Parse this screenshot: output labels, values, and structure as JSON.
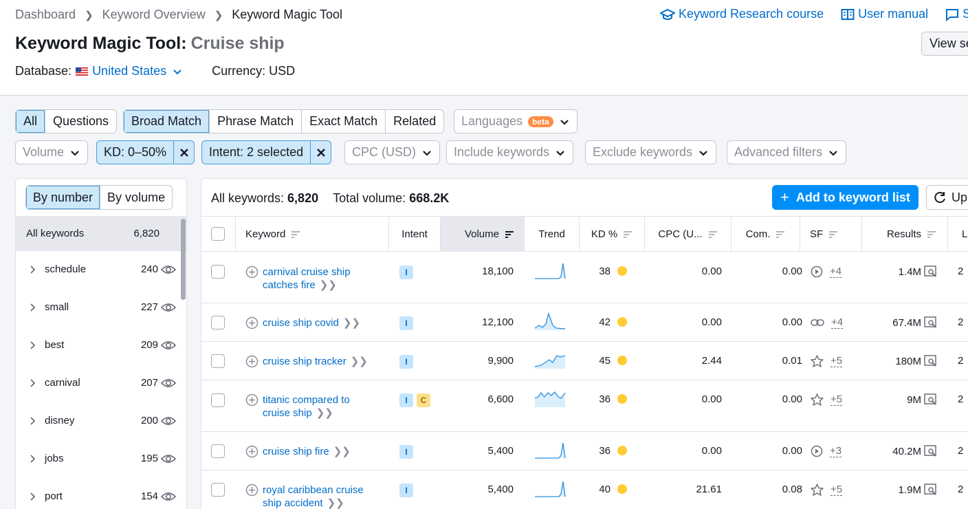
{
  "breadcrumb": [
    "Dashboard",
    "Keyword Overview",
    "Keyword Magic Tool"
  ],
  "top_links": {
    "course": "Keyword Research course",
    "manual": "User manual",
    "third": "S"
  },
  "title": {
    "prefix": "Keyword Magic Tool:",
    "query": "Cruise ship"
  },
  "view_button": "View se",
  "database": {
    "label": "Database:",
    "value": "United States",
    "currency": "Currency: USD"
  },
  "match_tabs": [
    "All",
    "Questions",
    "Broad Match",
    "Phrase Match",
    "Exact Match",
    "Related"
  ],
  "languages": {
    "label": "Languages",
    "badge": "beta"
  },
  "filters": {
    "volume": "Volume",
    "kd": "KD: 0–50%",
    "intent": "Intent: 2 selected",
    "cpc": "CPC (USD)",
    "include": "Include keywords",
    "exclude": "Exclude keywords",
    "advanced": "Advanced filters"
  },
  "side": {
    "tabs": [
      "By number",
      "By volume"
    ],
    "all_label": "All keywords",
    "all_count": "6,820",
    "groups": [
      {
        "name": "schedule",
        "count": "240"
      },
      {
        "name": "small",
        "count": "227"
      },
      {
        "name": "best",
        "count": "209"
      },
      {
        "name": "carnival",
        "count": "207"
      },
      {
        "name": "disney",
        "count": "200"
      },
      {
        "name": "jobs",
        "count": "195"
      },
      {
        "name": "port",
        "count": "154"
      }
    ]
  },
  "summary": {
    "all_label": "All keywords:",
    "all_value": "6,820",
    "vol_label": "Total volume:",
    "vol_value": "668.2K"
  },
  "add_button": "Add to keyword list",
  "update_button": "Up",
  "columns": [
    "Keyword",
    "Intent",
    "Volume",
    "Trend",
    "KD %",
    "CPC (U...",
    "Com.",
    "SF",
    "Results",
    "L"
  ],
  "rows": [
    {
      "kw1": "carnival cruise ship",
      "kw2": "catches fire",
      "intent": [
        "I"
      ],
      "volume": "18,100",
      "kd": "38",
      "cpc": "0.00",
      "com": "0.00",
      "sf_icon": "play-circle-icon",
      "sf": "+4",
      "results": "1.4M",
      "last": "2"
    },
    {
      "kw1": "cruise ship covid",
      "kw2": "",
      "intent": [
        "I"
      ],
      "volume": "12,100",
      "kd": "42",
      "cpc": "0.00",
      "com": "0.00",
      "sf_icon": "link-icon",
      "sf": "+4",
      "results": "67.4M",
      "last": "2"
    },
    {
      "kw1": "cruise ship tracker",
      "kw2": "",
      "intent": [
        "I"
      ],
      "volume": "9,900",
      "kd": "45",
      "cpc": "2.44",
      "com": "0.01",
      "sf_icon": "star-icon",
      "sf": "+5",
      "results": "180M",
      "last": "2"
    },
    {
      "kw1": "titanic compared to",
      "kw2": "cruise ship",
      "intent": [
        "I",
        "C"
      ],
      "volume": "6,600",
      "kd": "36",
      "cpc": "0.00",
      "com": "0.00",
      "sf_icon": "star-icon",
      "sf": "+5",
      "results": "9M",
      "last": "2"
    },
    {
      "kw1": "cruise ship fire",
      "kw2": "",
      "intent": [
        "I"
      ],
      "volume": "5,400",
      "kd": "36",
      "cpc": "0.00",
      "com": "0.00",
      "sf_icon": "play-circle-icon",
      "sf": "+3",
      "results": "40.2M",
      "last": "2"
    },
    {
      "kw1": "royal caribbean cruise",
      "kw2": "ship accident",
      "intent": [
        "I"
      ],
      "volume": "5,400",
      "kd": "40",
      "cpc": "21.61",
      "com": "0.08",
      "sf_icon": "star-icon",
      "sf": "+5",
      "results": "1.9M",
      "last": "2"
    }
  ],
  "colors": {
    "accent": "#006dca",
    "button": "#008ff8",
    "selected": "#cde8f9",
    "kd_dot": "#ffcc33",
    "beta": "#ff8c43"
  }
}
